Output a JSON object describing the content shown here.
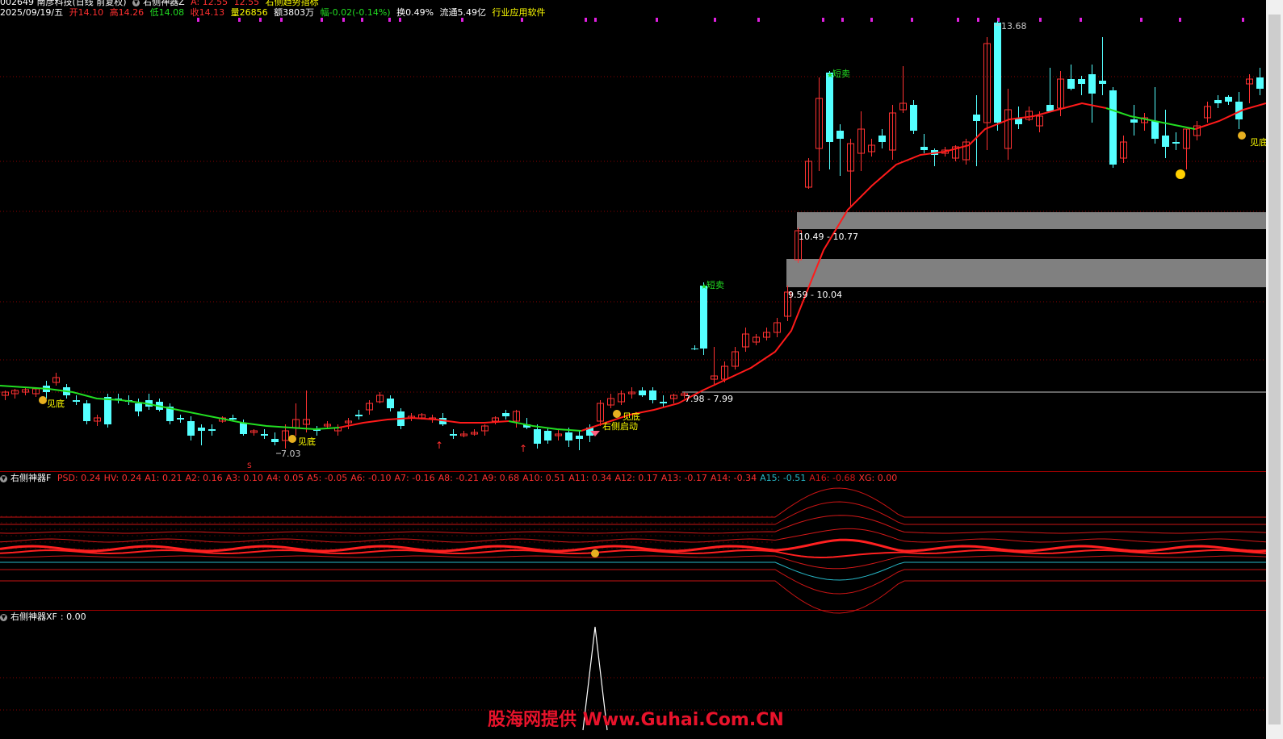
{
  "header": {
    "stock_line": "002649 南彦科技(日线 前复权)",
    "indicator_name": "右侧神器Z",
    "indicator_a": "A: 12.55",
    "indicator_b": "12.55",
    "indicator_desc": "右侧趋势指标",
    "date": "2025/09/19/五",
    "open": "开14.10",
    "high": "高14.26",
    "low": "低14.08",
    "close": "收14.13",
    "volume": "量26856",
    "amount": "额3803万",
    "change": "幅-0.02(-0.14%)",
    "turnover": "换0.49%",
    "float": "流通5.49亿",
    "industry": "行业应用软件"
  },
  "price_panel": {
    "labels": {
      "short_sell_1": "短卖",
      "short_sell_2": "短卖",
      "bottom_1": "见底",
      "bottom_2": "见底",
      "bottom_3": "见底",
      "bottom_4": "见底",
      "start": "右侧启动",
      "high_value": "13.68",
      "low_value": "7.03",
      "zone_upper": "10.49 - 10.77",
      "zone_lower": "9.59 - 10.04",
      "line_zone": "7.98 - 7.99",
      "s_marker": "S"
    }
  },
  "f_panel": {
    "title": "右侧神器F",
    "values": [
      {
        "label": "PSD: 0.24",
        "color": "#ff3030"
      },
      {
        "label": "HV: 0.24",
        "color": "#ff3030"
      },
      {
        "label": "A1: 0.21",
        "color": "#ff3030"
      },
      {
        "label": "A2: 0.16",
        "color": "#ff3030"
      },
      {
        "label": "A3: 0.10",
        "color": "#ff3030"
      },
      {
        "label": "A4: 0.05",
        "color": "#ff3030"
      },
      {
        "label": "A5: -0.05",
        "color": "#ff3030"
      },
      {
        "label": "A6: -0.10",
        "color": "#ff3030"
      },
      {
        "label": "A7: -0.16",
        "color": "#ff3030"
      },
      {
        "label": "A8: -0.21",
        "color": "#ff3030"
      },
      {
        "label": "A9: 0.68",
        "color": "#ff3030"
      },
      {
        "label": "A10: 0.51",
        "color": "#ff3030"
      },
      {
        "label": "A11: 0.34",
        "color": "#ff3030"
      },
      {
        "label": "A12: 0.17",
        "color": "#ff3030"
      },
      {
        "label": "A13: -0.17",
        "color": "#ff3030"
      },
      {
        "label": "A14: -0.34",
        "color": "#ff3030"
      },
      {
        "label": "A15: -0.51",
        "color": "#27b7c7"
      },
      {
        "label": "A16: -0.68",
        "color": "#d21818"
      },
      {
        "label": "XG: 0.00",
        "color": "#ff3030"
      }
    ]
  },
  "xf_panel": {
    "title": "右侧神器XF",
    "value": ": 0.00"
  },
  "watermark": "股海网提供 Www.Guhai.Com.CN",
  "colors": {
    "up": "#ff3232",
    "down": "#54ffff",
    "ma_red": "#ff1a1a",
    "ma_green": "#22dd22",
    "grid": "#8a0000",
    "zone": "#808080"
  }
}
